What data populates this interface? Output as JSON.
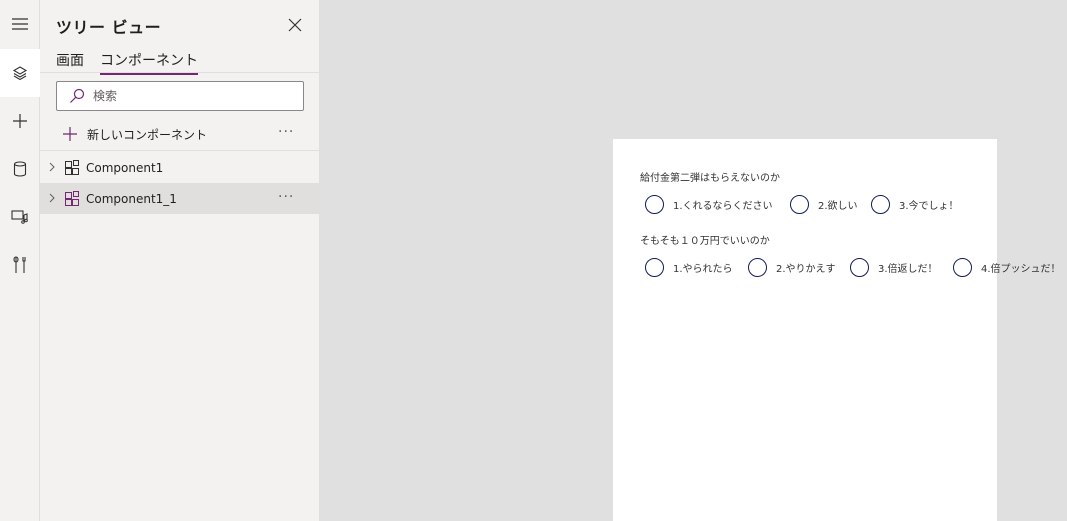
{
  "rail": {
    "items": [
      {
        "icon": "hamburger-icon"
      },
      {
        "icon": "layers-icon",
        "active": true
      },
      {
        "icon": "plus-icon"
      },
      {
        "icon": "database-icon"
      },
      {
        "icon": "media-icon"
      },
      {
        "icon": "tools-icon"
      }
    ]
  },
  "panel": {
    "title": "ツリー ビュー",
    "tabs": [
      {
        "label": "画面",
        "active": false
      },
      {
        "label": "コンポーネント",
        "active": true
      }
    ],
    "search": {
      "placeholder": "検索",
      "value": ""
    },
    "new_component_label": "新しいコンポーネント",
    "more_label": "···",
    "tree": [
      {
        "name": "Component1",
        "selected": false
      },
      {
        "name": "Component1_1",
        "selected": true
      }
    ]
  },
  "screen": {
    "questions": [
      {
        "label": "給付金第二弾はもらえないのか",
        "options": [
          "1.くれるならください",
          "2.欲しい",
          "3.今でしょ！"
        ]
      },
      {
        "label": "そもそも１０万円でいいのか",
        "options": [
          "1.やられたら",
          "2.やりかえす",
          "3.倍返しだ！",
          "4.倍プッシュだ！"
        ]
      }
    ]
  },
  "colors": {
    "accent": "#742774",
    "radio_border": "#0f1c5a",
    "canvas_bg": "#e0e0e0",
    "panel_bg": "#f3f2f1"
  }
}
